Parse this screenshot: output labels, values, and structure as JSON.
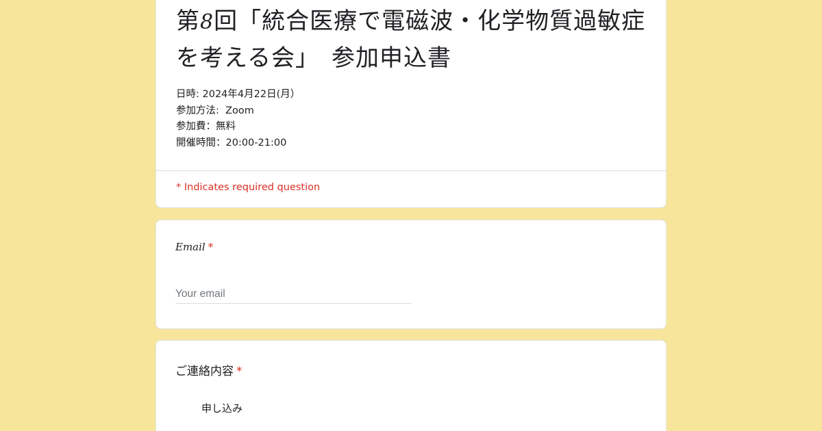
{
  "form": {
    "title_prefix": "第",
    "title_number": "8",
    "title_rest": "回「統合医療で電磁波・化学物質過敏症を考える会」　参加申込書",
    "info_lines": [
      "日時: 2024年4月22日(月）",
      "参加方法:  Zoom",
      "参加費：無料",
      "開催時間：20:00-21:00"
    ],
    "required_note": "* Indicates required question"
  },
  "email_question": {
    "label": "Email",
    "required_mark": "*",
    "placeholder": "Your email"
  },
  "contact_question": {
    "label": "ご連絡内容",
    "required_mark": "*",
    "options": [
      "申し込み"
    ]
  },
  "colors": {
    "background": "#f7e59c",
    "required": "#d93025"
  }
}
